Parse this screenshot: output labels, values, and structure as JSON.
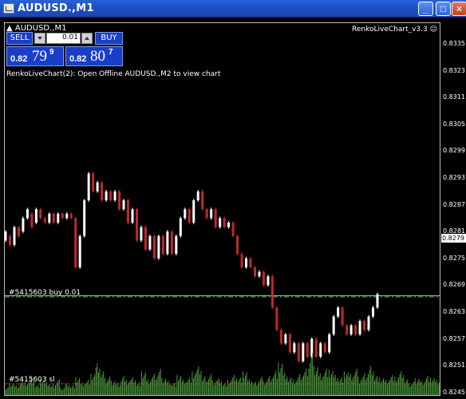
{
  "window": {
    "title": "AUDUSD.,M1",
    "min_icon": "minimize-icon",
    "max_icon": "maximize-icon",
    "close_icon": "close-icon"
  },
  "chart": {
    "symbol_label": "AUDUSD.,M1",
    "indicator_label": "RenkoLiveChart_v3.3 ☺",
    "info_text": "RenkoLiveChart(2): Open Offline AUDUSD.,M2 to view chart",
    "order_label": "#5415603 buy 0.01",
    "sl_label": "#5415603 sl",
    "current_price": "0.8279",
    "price_labels": [
      "0.8335",
      "0.8323",
      "0.8311",
      "0.8305",
      "0.8299",
      "0.8293",
      "0.8287",
      "0.8281",
      "0.8275",
      "0.8269",
      "0.8263",
      "0.8257",
      "0.8251",
      "0.8245"
    ],
    "colors": {
      "bull": "#ffffff",
      "bear": "#c0282c",
      "volume": "#4a9c3a",
      "order_line": "#3cc03c",
      "sl_line": "#c0282c",
      "bid_line": "#c0c0c0"
    }
  },
  "trade_panel": {
    "sell_label": "SELL",
    "buy_label": "BUY",
    "lot": "0.01",
    "sell_price_small": "0.82",
    "sell_price_big": "79",
    "sell_price_sup": "9",
    "buy_price_small": "0.82",
    "buy_price_big": "80",
    "buy_price_sup": "7"
  },
  "chart_data": {
    "type": "bar",
    "candles": [
      [
        0.8291,
        0.8293
      ],
      [
        0.8292,
        0.829
      ],
      [
        0.829,
        0.8294
      ],
      [
        0.8294,
        0.8292
      ],
      [
        0.8293,
        0.8296
      ],
      [
        0.8296,
        0.8298
      ],
      [
        0.8297,
        0.8294
      ],
      [
        0.8295,
        0.8298
      ],
      [
        0.8298,
        0.8296
      ],
      [
        0.8296,
        0.8295
      ],
      [
        0.8295,
        0.8297
      ],
      [
        0.8297,
        0.8295
      ],
      [
        0.8295,
        0.8297
      ],
      [
        0.8297,
        0.8296
      ],
      [
        0.8296,
        0.8297
      ],
      [
        0.8297,
        0.8296
      ],
      [
        0.8296,
        0.8285
      ],
      [
        0.8285,
        0.8292
      ],
      [
        0.8292,
        0.83
      ],
      [
        0.83,
        0.8306
      ],
      [
        0.8306,
        0.8302
      ],
      [
        0.8302,
        0.8304
      ],
      [
        0.8304,
        0.83
      ],
      [
        0.83,
        0.8302
      ],
      [
        0.8302,
        0.83
      ],
      [
        0.83,
        0.8302
      ],
      [
        0.8302,
        0.8298
      ],
      [
        0.8298,
        0.83
      ],
      [
        0.83,
        0.8295
      ],
      [
        0.8295,
        0.8298
      ],
      [
        0.8298,
        0.8291
      ],
      [
        0.8291,
        0.8294
      ],
      [
        0.8294,
        0.8289
      ],
      [
        0.8289,
        0.8292
      ],
      [
        0.8292,
        0.8287
      ],
      [
        0.8287,
        0.8292
      ],
      [
        0.8292,
        0.8288
      ],
      [
        0.8288,
        0.8293
      ],
      [
        0.8293,
        0.8288
      ],
      [
        0.8288,
        0.8292
      ],
      [
        0.8292,
        0.8296
      ],
      [
        0.8296,
        0.8298
      ],
      [
        0.8298,
        0.8295
      ],
      [
        0.8295,
        0.83
      ],
      [
        0.83,
        0.8302
      ],
      [
        0.8302,
        0.8298
      ],
      [
        0.8298,
        0.8296
      ],
      [
        0.8296,
        0.8298
      ],
      [
        0.8298,
        0.8294
      ],
      [
        0.8294,
        0.8296
      ],
      [
        0.8296,
        0.8294
      ],
      [
        0.8294,
        0.8295
      ],
      [
        0.8295,
        0.8292
      ],
      [
        0.8292,
        0.8288
      ],
      [
        0.8288,
        0.8285
      ],
      [
        0.8285,
        0.8287
      ],
      [
        0.8287,
        0.8285
      ],
      [
        0.8285,
        0.8283
      ],
      [
        0.8283,
        0.8284
      ],
      [
        0.8284,
        0.8281
      ],
      [
        0.8281,
        0.8283
      ],
      [
        0.8283,
        0.8276
      ],
      [
        0.8276,
        0.8271
      ],
      [
        0.8271,
        0.8268
      ],
      [
        0.8268,
        0.827
      ],
      [
        0.827,
        0.8266
      ],
      [
        0.8266,
        0.8268
      ],
      [
        0.8268,
        0.8264
      ],
      [
        0.8264,
        0.8268
      ],
      [
        0.8268,
        0.8265
      ],
      [
        0.8265,
        0.8269
      ],
      [
        0.8269,
        0.8265
      ],
      [
        0.8265,
        0.8268
      ],
      [
        0.8268,
        0.8266
      ],
      [
        0.8266,
        0.827
      ],
      [
        0.827,
        0.8274
      ],
      [
        0.8274,
        0.8276
      ],
      [
        0.8276,
        0.8272
      ],
      [
        0.8272,
        0.827
      ],
      [
        0.827,
        0.8272
      ],
      [
        0.8272,
        0.827
      ],
      [
        0.827,
        0.8273
      ],
      [
        0.8273,
        0.8271
      ],
      [
        0.8271,
        0.8274
      ],
      [
        0.8274,
        0.8276
      ],
      [
        0.8276,
        0.8279
      ]
    ],
    "volumes": [
      3,
      5,
      4,
      6,
      5,
      7,
      4,
      6,
      5,
      4,
      6,
      3,
      5,
      4,
      7,
      5,
      6,
      8,
      12,
      9,
      7,
      6,
      5,
      8,
      6,
      7,
      5,
      9,
      6,
      8,
      10,
      7,
      6,
      5,
      8,
      6,
      7,
      9,
      11,
      7,
      8,
      6,
      7,
      5,
      6,
      8,
      7,
      9,
      6,
      5,
      7,
      6,
      8,
      10,
      13,
      9,
      7,
      6,
      8,
      10,
      16,
      12,
      9,
      11,
      10,
      8,
      7,
      9,
      8,
      10,
      7,
      9,
      12,
      8,
      7,
      6,
      8,
      7,
      9,
      6,
      5,
      7,
      6,
      8,
      7,
      6
    ],
    "ylim": [
      0.8243,
      0.8338
    ]
  }
}
